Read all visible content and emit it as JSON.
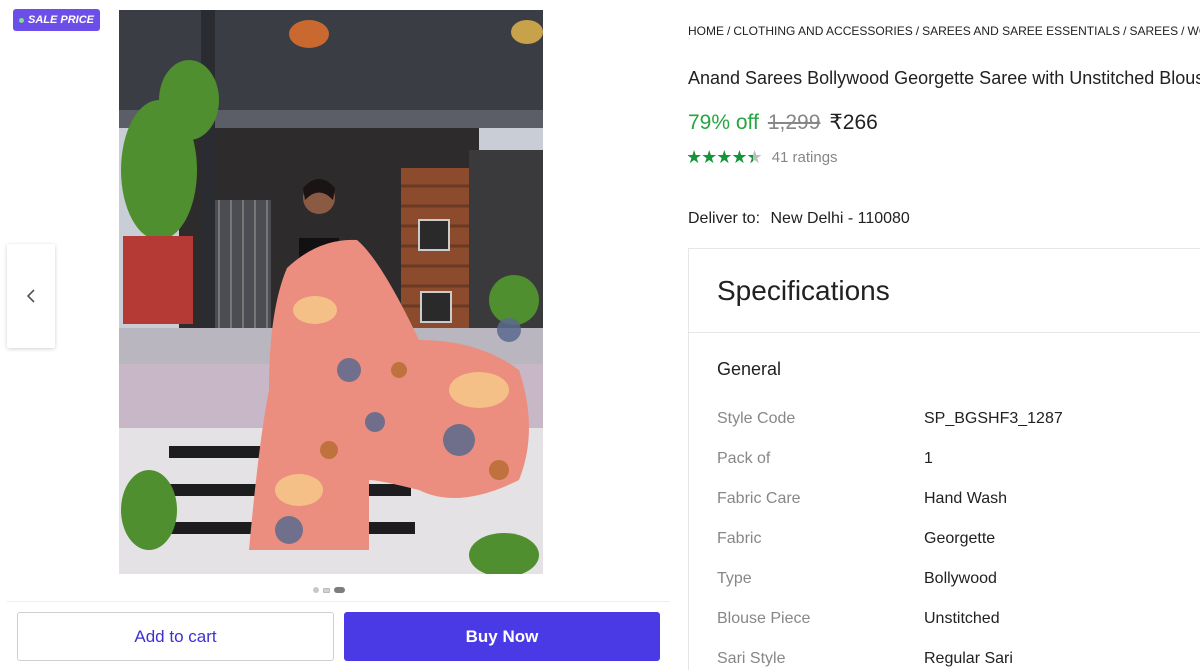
{
  "badge": {
    "label": "SALE PRICE"
  },
  "gallery": {
    "prev_icon": "chevron-left-icon",
    "image_alt": "Woman in peach floral georgette saree posing on balcony",
    "dot_count": 3,
    "active_dot": 2
  },
  "actions": {
    "add_to_cart": "Add to cart",
    "buy_now": "Buy Now"
  },
  "breadcrumb": [
    "HOME",
    "CLOTHING AND ACCESSORIES",
    "SAREES AND SAREE ESSENTIALS",
    "SAREES",
    "WOMEN"
  ],
  "product": {
    "title": "Anand Sarees Bollywood Georgette Saree with Unstitched Blouse",
    "discount": "79% off",
    "mrp": "1,299",
    "price": "₹266",
    "rating_value": 4.3,
    "ratings_text": "41 ratings"
  },
  "delivery": {
    "label": "Deliver to:",
    "location": "New Delhi - 110080"
  },
  "specifications": {
    "title": "Specifications",
    "group": "General",
    "rows": [
      {
        "key": "Style Code",
        "value": "SP_BGSHF3_1287"
      },
      {
        "key": "Pack of",
        "value": "1"
      },
      {
        "key": "Fabric Care",
        "value": "Hand Wash"
      },
      {
        "key": "Fabric",
        "value": "Georgette"
      },
      {
        "key": "Type",
        "value": "Bollywood"
      },
      {
        "key": "Blouse Piece",
        "value": "Unstitched"
      },
      {
        "key": "Sari Style",
        "value": "Regular Sari"
      }
    ]
  },
  "colors": {
    "accent": "#4a3ae6",
    "badge": "#6c4fe8",
    "discount_green": "#26a541",
    "star_green": "#14953a"
  }
}
